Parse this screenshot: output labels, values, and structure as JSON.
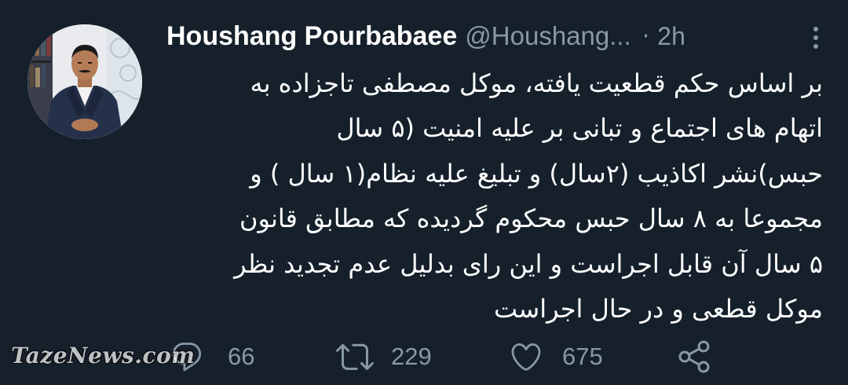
{
  "author": {
    "name": "Houshang Pourbabaee",
    "handle": "@Houshang...",
    "separator": "·",
    "time": "2h"
  },
  "tweet": {
    "lines": [
      "بر اساس حکم قطعیت یافته، موکل مصطفی تاجزاده به",
      "اتهام های اجتماع و تبانی بر علیه امنیت (۵ سال",
      "حبس)نشر اکاذیب (۲سال) و تبلیغ علیه نظام(۱ سال ) و",
      "مجموعا به ۸ سال حبس محکوم گردیده که مطابق قانون",
      "۵ سال آن قابل اجراست و این رای بدلیل عدم تجدید نظر",
      "موکل قطعی و در حال اجراست"
    ]
  },
  "actions": {
    "reply": {
      "icon": "reply-icon",
      "count": "66"
    },
    "retweet": {
      "icon": "retweet-icon",
      "count": "229"
    },
    "like": {
      "icon": "heart-icon",
      "count": "675"
    },
    "share": {
      "icon": "share-icon"
    }
  },
  "more_icon": "more-options-icon",
  "watermark": {
    "text": "TazeNews.com"
  },
  "colors": {
    "background": "#15202b",
    "text": "#ffffff",
    "secondary": "#8899a6"
  }
}
